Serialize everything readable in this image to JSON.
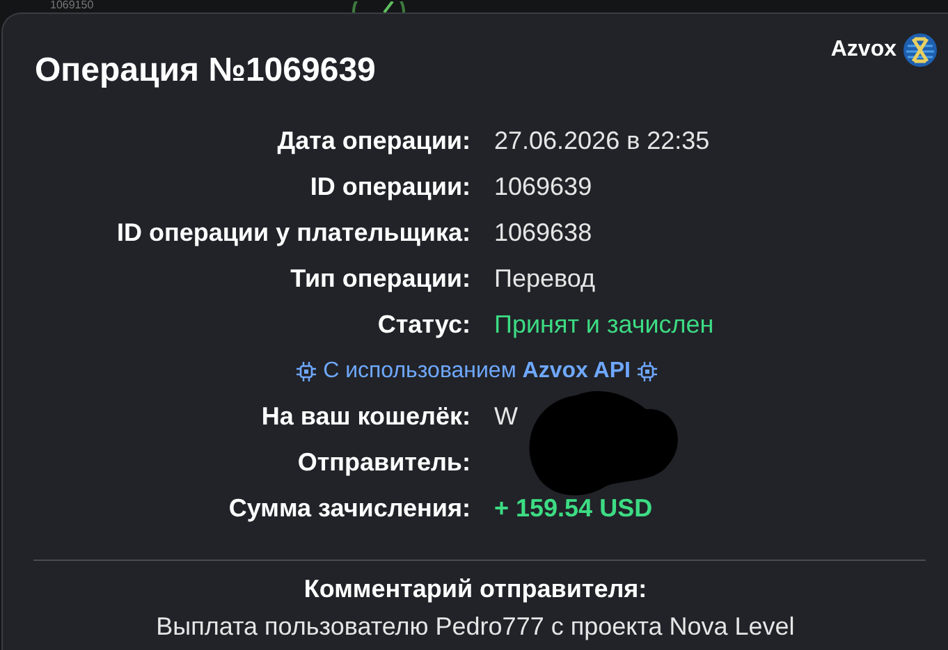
{
  "background": {
    "id": "1069150"
  },
  "modal": {
    "title": "Операция №1069639",
    "brand": "Azvox",
    "rows": [
      {
        "label": "Дата операции:",
        "value": "27.06.2026 в 22:35",
        "kind": "text"
      },
      {
        "label": "ID операции:",
        "value": "1069639",
        "kind": "text"
      },
      {
        "label": "ID операции у плательщика:",
        "value": "1069638",
        "kind": "text"
      },
      {
        "label": "Тип операции:",
        "value": "Перевод",
        "kind": "text"
      },
      {
        "label": "Статус:",
        "value": "Принят и зачислен",
        "kind": "status"
      },
      {
        "kind": "api",
        "value": "С использованием **Azvox API**"
      },
      {
        "label": "На ваш кошелёк:",
        "value": "W",
        "kind": "text"
      },
      {
        "label": "Отправитель:",
        "kind": "text"
      },
      {
        "label": "Сумма зачисления:",
        "value": "+ 159.54 USD",
        "kind": "amount"
      }
    ],
    "comment": {
      "title": "Комментарий отправителя:",
      "text": "Выплата пользователю Pedro777 с проекта Nova Level"
    }
  }
}
